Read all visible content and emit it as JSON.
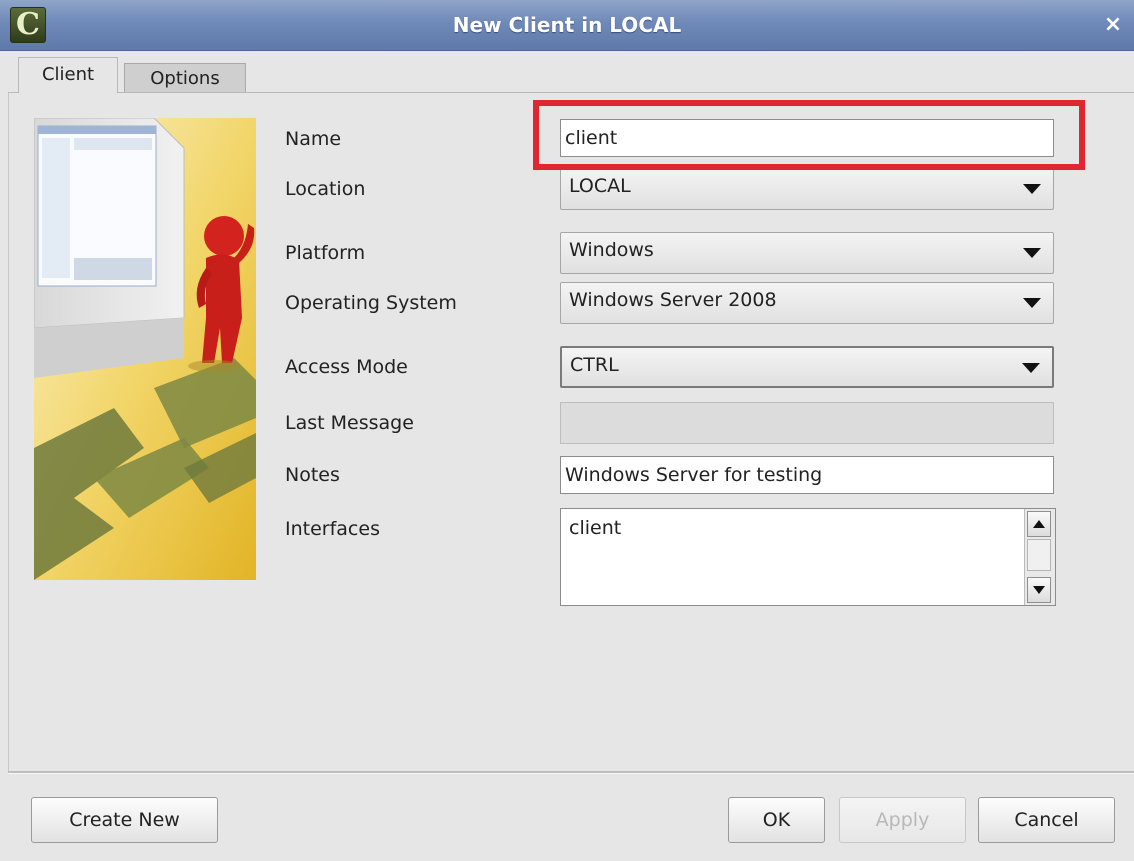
{
  "window": {
    "title": "New Client in LOCAL",
    "app_icon_letter": "C",
    "close_glyph": "×"
  },
  "tabs": [
    {
      "label": "Client",
      "active": true
    },
    {
      "label": "Options",
      "active": false
    }
  ],
  "form": {
    "name": {
      "label": "Name",
      "value": "client"
    },
    "location": {
      "label": "Location",
      "value": "LOCAL"
    },
    "platform": {
      "label": "Platform",
      "value": "Windows"
    },
    "operating_system": {
      "label": "Operating System",
      "value": "Windows Server 2008"
    },
    "access_mode": {
      "label": "Access Mode",
      "value": "CTRL"
    },
    "last_message": {
      "label": "Last Message",
      "value": ""
    },
    "notes": {
      "label": "Notes",
      "value": "Windows Server for testing"
    },
    "interfaces": {
      "label": "Interfaces",
      "value": "client"
    }
  },
  "buttons": {
    "create_new": "Create New",
    "ok": "OK",
    "apply": "Apply",
    "cancel": "Cancel"
  },
  "colors": {
    "highlight": "#e02630",
    "titlebar": "#6f89b8"
  }
}
